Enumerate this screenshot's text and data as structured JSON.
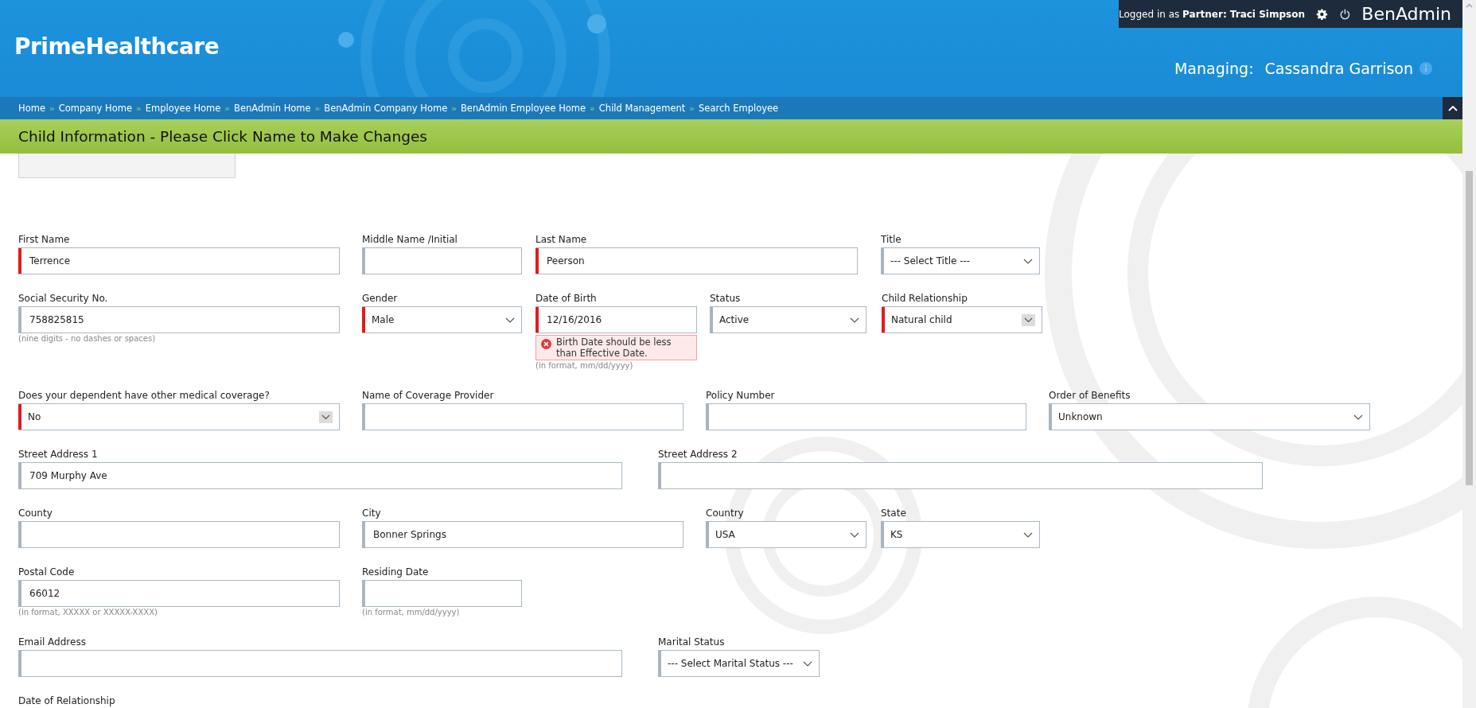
{
  "header": {
    "logo": "PrimeHealthcare",
    "session": "Logged in as **Partner:  Traci Simpson**",
    "app_name": "BenAdmin",
    "managing_label": "Managing:",
    "managing_name": "Cassandra Garrison"
  },
  "breadcrumb": {
    "separator": "»",
    "items": [
      "Home",
      "Company Home",
      "Employee Home",
      "BenAdmin Home",
      "BenAdmin Company Home",
      "BenAdmin Employee Home",
      "Child Management",
      "Search Employee"
    ]
  },
  "page_title": "Child Information - Please Click Name to Make Changes",
  "form": {
    "rows": [
      {
        "fields": [
          {
            "label": "First Name",
            "kind": "text",
            "value": "Terrence",
            "required": true
          },
          {
            "label": "Middle Name /Initial",
            "kind": "text",
            "required": false
          },
          {
            "label": "Last Name",
            "kind": "text",
            "value": "Peerson",
            "required": true
          },
          {
            "label": "Title",
            "kind": "select",
            "value": "--- Select Title ---",
            "required": false
          }
        ]
      },
      {
        "fields": [
          {
            "label": "Social Security No.",
            "kind": "text",
            "value": "758825815",
            "required": false,
            "hint": "(nine digits - no dashes or spaces)"
          },
          {
            "label": "Gender",
            "kind": "select",
            "value": "Male",
            "required": true
          },
          {
            "label": "Date of Birth",
            "kind": "text",
            "value": "12/16/2016",
            "required": true,
            "error": "Birth Date should be less than Effective Date.",
            "hint": "(in format, mm/dd/yyyy)"
          },
          {
            "label": "Status",
            "kind": "select",
            "value": "Active",
            "required": false
          },
          {
            "label": "Child Relationship",
            "kind": "combo",
            "value": "Natural child",
            "required": true
          }
        ]
      },
      {
        "fields": [
          {
            "label": "Does your dependent have other medical coverage?",
            "kind": "combo",
            "value": "No",
            "required": true
          },
          {
            "label": "Name of Coverage Provider",
            "kind": "text",
            "required": false
          },
          {
            "label": "Policy Number",
            "kind": "text",
            "required": false
          },
          {
            "label": "Order of Benefits",
            "kind": "select",
            "value": "Unknown",
            "required": false
          }
        ]
      },
      {
        "fields": [
          {
            "label": "Street Address 1",
            "kind": "text",
            "value": "709 Murphy Ave",
            "required": false
          },
          {
            "label": "Street Address 2",
            "kind": "text",
            "required": false
          }
        ]
      },
      {
        "fields": [
          {
            "label": "County",
            "kind": "text",
            "required": false
          },
          {
            "label": "City",
            "kind": "text",
            "value": "Bonner Springs",
            "required": false
          },
          {
            "label": "Country",
            "kind": "select",
            "value": "USA",
            "required": false
          },
          {
            "label": "State",
            "kind": "select",
            "value": "KS",
            "required": false
          }
        ]
      },
      {
        "fields": [
          {
            "label": "Postal Code",
            "kind": "text",
            "value": "66012",
            "required": false,
            "hint": "(in format, XXXXX or XXXXX-XXXX)"
          },
          {
            "label": "Residing Date",
            "kind": "text",
            "required": false,
            "hint": "(in format, mm/dd/yyyy)"
          }
        ]
      },
      {
        "fields": [
          {
            "label": "Email Address",
            "kind": "text",
            "required": false
          },
          {
            "label": "Marital Status",
            "kind": "select",
            "value": "--- Select Marital Status ---",
            "required": false
          }
        ]
      },
      {
        "fields": [
          {
            "label": "Date of Relationship"
          }
        ]
      }
    ]
  }
}
